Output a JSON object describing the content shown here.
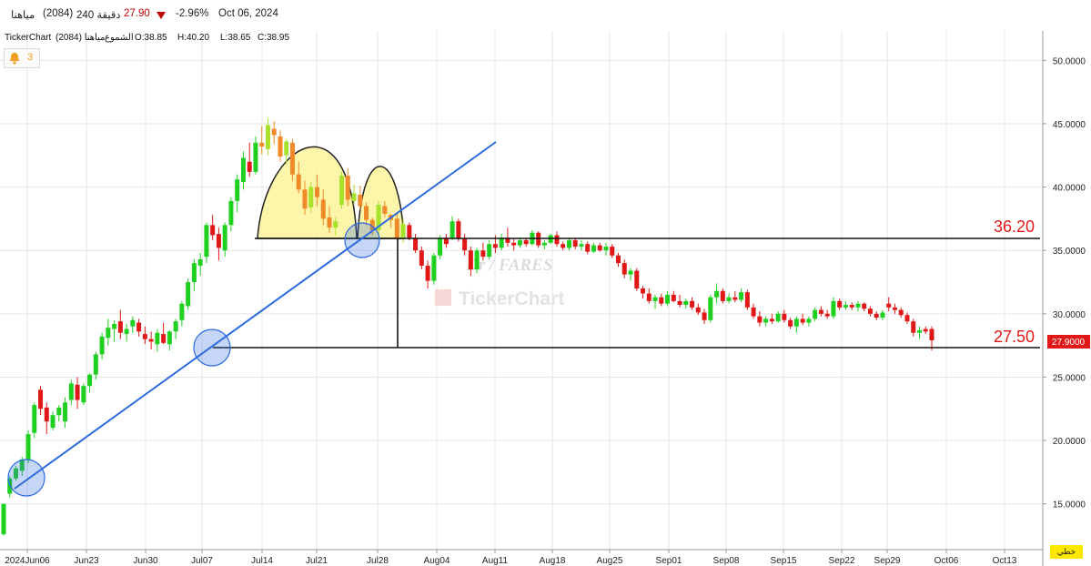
{
  "header": {
    "symbol_name": "مياهنا",
    "symbol_code": "(2084)",
    "interval": "240 دقيقة",
    "price": "27.90",
    "change_pct": "-2.96%",
    "date": "Oct 06, 2024"
  },
  "infobar": {
    "source": "TickerChart",
    "symbol": "مياهنا (2084)",
    "type": "الشموع",
    "open": "O:38.85",
    "high": "H:40.20",
    "low": "L:38.65",
    "close": "C:38.95"
  },
  "alerts": {
    "count": "3"
  },
  "corner_label": "خطي",
  "watermarks": {
    "author": "Dr / FARES",
    "brand": "TickerChart"
  },
  "colors": {
    "up": "#20d020",
    "down": "#e01818",
    "hl_up": "#a8e22c",
    "hl_down": "#f08a28",
    "trendline": "#2d6be0",
    "pattern_fill": "#fdf39a",
    "label": "#e01818",
    "grid": "#e6e6e6"
  },
  "chart_data": {
    "type": "candlestick",
    "ylim": [
      12.5,
      52.5
    ],
    "yticks": [
      "15.0000",
      "20.0000",
      "25.0000",
      "30.0000",
      "35.0000",
      "40.0000",
      "45.0000",
      "50.0000"
    ],
    "grid": true,
    "x_labels": [
      "2024Jun06",
      "Jun23",
      "Jun30",
      "Jul07",
      "Jul14",
      "Jul21",
      "Jul28",
      "Aug04",
      "Aug11",
      "Aug18",
      "Aug25",
      "Sep01",
      "Sep08",
      "Sep15",
      "Sep22",
      "Sep29",
      "Oct06",
      "Oct13"
    ],
    "last_price": "27.9000",
    "levels": [
      {
        "value": 36.2,
        "label": "36.20"
      },
      {
        "value": 27.5,
        "label": "27.50"
      }
    ],
    "candles": [
      [
        12.6,
        15.0,
        12.5,
        15.0
      ],
      [
        15.8,
        17.2,
        15.5,
        17.0
      ],
      [
        17.0,
        18.0,
        16.8,
        17.8
      ],
      [
        17.6,
        18.7,
        17.2,
        18.5
      ],
      [
        18.5,
        20.8,
        18.2,
        20.5
      ],
      [
        20.6,
        23.0,
        20.2,
        22.8
      ],
      [
        24.0,
        24.3,
        22.0,
        22.5
      ],
      [
        22.6,
        23.0,
        20.5,
        21.5
      ],
      [
        21.0,
        22.3,
        20.8,
        22.0
      ],
      [
        22.0,
        22.8,
        21.5,
        22.6
      ],
      [
        21.5,
        23.4,
        21.0,
        23.0
      ],
      [
        23.2,
        24.8,
        22.8,
        24.5
      ],
      [
        24.4,
        25.0,
        22.5,
        23.2
      ],
      [
        23.0,
        24.5,
        22.8,
        24.3
      ],
      [
        24.3,
        25.3,
        23.8,
        25.2
      ],
      [
        25.2,
        27.0,
        24.8,
        26.8
      ],
      [
        26.8,
        28.5,
        26.4,
        28.2
      ],
      [
        28.1,
        29.6,
        27.5,
        28.9
      ],
      [
        28.8,
        29.5,
        27.8,
        29.2
      ],
      [
        29.4,
        30.3,
        28.0,
        28.5
      ],
      [
        28.4,
        29.2,
        27.8,
        28.8
      ],
      [
        29.0,
        29.8,
        28.5,
        29.5
      ],
      [
        29.3,
        29.6,
        28.2,
        28.6
      ],
      [
        28.4,
        29.0,
        27.6,
        28.0
      ],
      [
        28.0,
        28.6,
        27.2,
        27.8
      ],
      [
        27.6,
        28.8,
        27.0,
        28.5
      ],
      [
        28.4,
        29.3,
        27.6,
        27.7
      ],
      [
        27.6,
        28.7,
        27.1,
        28.6
      ],
      [
        28.6,
        29.6,
        28.0,
        29.4
      ],
      [
        29.5,
        31.0,
        29.0,
        30.8
      ],
      [
        30.6,
        32.8,
        30.3,
        32.5
      ],
      [
        32.5,
        34.3,
        31.8,
        34.0
      ],
      [
        33.8,
        34.8,
        33.0,
        34.3
      ],
      [
        34.5,
        37.2,
        34.0,
        37.0
      ],
      [
        37.0,
        37.8,
        35.8,
        36.2
      ],
      [
        36.3,
        36.8,
        34.2,
        35.2
      ],
      [
        35.0,
        37.2,
        34.5,
        37.0
      ],
      [
        37.0,
        39.2,
        36.5,
        38.9
      ],
      [
        38.9,
        41.0,
        38.0,
        40.6
      ],
      [
        40.4,
        42.8,
        39.8,
        42.3
      ],
      [
        42.0,
        43.5,
        40.8,
        41.2
      ],
      [
        41.2,
        44.0,
        41.0,
        43.5
      ],
      [
        43.5,
        44.8,
        42.6,
        43.2
      ],
      [
        43.0,
        45.4,
        42.5,
        44.9
      ],
      [
        44.6,
        45.2,
        43.4,
        44.1
      ],
      [
        44.0,
        44.5,
        42.0,
        42.4
      ],
      [
        42.5,
        43.8,
        41.8,
        43.6
      ],
      [
        43.5,
        43.8,
        40.5,
        41.0
      ],
      [
        41.0,
        42.0,
        39.5,
        39.8
      ],
      [
        39.8,
        40.5,
        37.8,
        38.3
      ],
      [
        38.4,
        40.4,
        38.0,
        40.0
      ],
      [
        40.0,
        41.0,
        38.5,
        39.2
      ],
      [
        39.0,
        39.8,
        37.0,
        37.5
      ],
      [
        37.6,
        38.5,
        36.4,
        36.8
      ],
      [
        36.8,
        37.6,
        36.2,
        37.3
      ],
      [
        38.6,
        41.2,
        38.3,
        40.9
      ],
      [
        40.9,
        41.5,
        38.5,
        39.0
      ],
      [
        38.9,
        40.2,
        38.6,
        39.5
      ],
      [
        39.4,
        40.1,
        38.2,
        38.5
      ],
      [
        38.5,
        38.8,
        37.0,
        37.4
      ],
      [
        37.4,
        37.6,
        36.2,
        36.6
      ],
      [
        36.6,
        38.9,
        36.3,
        38.6
      ],
      [
        38.5,
        38.9,
        37.6,
        37.9
      ],
      [
        37.8,
        37.9,
        36.8,
        37.4
      ],
      [
        37.5,
        37.9,
        35.8,
        36.0
      ],
      [
        36.0,
        37.5,
        35.6,
        37.1
      ],
      [
        37.0,
        37.2,
        35.8,
        36.0
      ],
      [
        36.0,
        36.3,
        34.8,
        35.0
      ],
      [
        35.0,
        35.3,
        33.5,
        33.8
      ],
      [
        33.8,
        34.2,
        32.0,
        32.6
      ],
      [
        32.6,
        34.8,
        32.3,
        34.6
      ],
      [
        34.6,
        36.2,
        34.3,
        36.0
      ],
      [
        36.0,
        36.3,
        35.2,
        35.5
      ],
      [
        36.0,
        37.7,
        35.8,
        37.3
      ],
      [
        37.3,
        37.5,
        35.7,
        35.9
      ],
      [
        35.9,
        36.3,
        34.6,
        35.0
      ],
      [
        35.0,
        35.3,
        33.0,
        33.5
      ],
      [
        33.5,
        35.2,
        33.2,
        35.0
      ],
      [
        35.0,
        35.6,
        34.2,
        34.5
      ],
      [
        34.5,
        35.8,
        34.3,
        35.5
      ],
      [
        35.5,
        36.2,
        34.8,
        35.2
      ],
      [
        35.2,
        36.3,
        35.0,
        36.0
      ],
      [
        36.0,
        36.8,
        35.3,
        35.6
      ],
      [
        35.6,
        35.9,
        35.0,
        35.4
      ],
      [
        35.4,
        36.0,
        35.2,
        35.8
      ],
      [
        35.8,
        36.0,
        35.3,
        35.5
      ],
      [
        35.5,
        36.6,
        35.4,
        36.4
      ],
      [
        36.4,
        36.5,
        35.2,
        35.4
      ],
      [
        35.4,
        35.8,
        35.1,
        35.6
      ],
      [
        35.6,
        36.3,
        35.5,
        36.2
      ],
      [
        36.2,
        36.5,
        35.3,
        35.5
      ],
      [
        35.5,
        35.7,
        35.0,
        35.2
      ],
      [
        35.2,
        36.0,
        35.0,
        35.8
      ],
      [
        35.8,
        36.0,
        35.1,
        35.3
      ],
      [
        35.3,
        35.8,
        35.0,
        35.5
      ],
      [
        35.5,
        35.7,
        34.7,
        34.9
      ],
      [
        34.9,
        35.6,
        34.8,
        35.4
      ],
      [
        35.4,
        35.6,
        34.9,
        35.0
      ],
      [
        35.0,
        35.6,
        34.6,
        35.3
      ],
      [
        35.3,
        35.5,
        34.4,
        34.6
      ],
      [
        34.6,
        34.8,
        33.7,
        34.0
      ],
      [
        34.0,
        34.3,
        32.8,
        33.1
      ],
      [
        33.1,
        33.6,
        32.6,
        33.4
      ],
      [
        33.4,
        33.6,
        31.8,
        32.0
      ],
      [
        32.0,
        32.2,
        31.2,
        31.6
      ],
      [
        31.6,
        32.0,
        30.8,
        31.0
      ],
      [
        31.0,
        31.5,
        30.4,
        31.3
      ],
      [
        31.3,
        31.6,
        30.6,
        30.8
      ],
      [
        30.8,
        31.8,
        30.6,
        31.5
      ],
      [
        31.5,
        31.8,
        30.9,
        31.0
      ],
      [
        31.0,
        31.5,
        30.5,
        30.7
      ],
      [
        30.7,
        31.2,
        30.4,
        31.0
      ],
      [
        31.0,
        31.3,
        30.3,
        30.5
      ],
      [
        30.5,
        30.8,
        29.9,
        30.1
      ],
      [
        30.1,
        30.4,
        29.2,
        29.5
      ],
      [
        29.5,
        31.5,
        29.3,
        31.3
      ],
      [
        31.3,
        32.4,
        30.8,
        31.8
      ],
      [
        31.8,
        32.0,
        30.8,
        31.0
      ],
      [
        31.0,
        31.6,
        30.8,
        31.3
      ],
      [
        31.3,
        31.8,
        30.9,
        31.1
      ],
      [
        31.1,
        32.0,
        30.9,
        31.7
      ],
      [
        31.7,
        31.9,
        30.3,
        30.5
      ],
      [
        30.5,
        30.8,
        29.6,
        29.8
      ],
      [
        29.8,
        30.2,
        29.0,
        29.3
      ],
      [
        29.3,
        29.8,
        29.0,
        29.6
      ],
      [
        29.6,
        30.0,
        29.2,
        29.4
      ],
      [
        29.4,
        30.2,
        29.3,
        30.0
      ],
      [
        30.0,
        30.3,
        29.3,
        29.5
      ],
      [
        29.5,
        29.7,
        28.8,
        29.0
      ],
      [
        29.0,
        29.8,
        28.5,
        29.6
      ],
      [
        29.6,
        30.0,
        29.1,
        29.3
      ],
      [
        29.3,
        29.8,
        29.0,
        29.6
      ],
      [
        29.6,
        30.5,
        29.4,
        30.3
      ],
      [
        30.3,
        30.6,
        29.8,
        30.0
      ],
      [
        30.0,
        30.3,
        29.6,
        29.8
      ],
      [
        29.8,
        31.3,
        29.6,
        31.0
      ],
      [
        31.0,
        31.2,
        30.3,
        30.5
      ],
      [
        30.5,
        31.0,
        30.3,
        30.7
      ],
      [
        30.7,
        30.9,
        30.3,
        30.5
      ],
      [
        30.5,
        31.0,
        30.2,
        30.8
      ],
      [
        30.8,
        30.9,
        30.2,
        30.4
      ],
      [
        30.4,
        30.6,
        29.8,
        30.0
      ],
      [
        30.0,
        30.2,
        29.5,
        29.7
      ],
      [
        29.7,
        30.3,
        29.5,
        30.1
      ],
      [
        30.8,
        31.3,
        30.2,
        30.5
      ],
      [
        30.5,
        30.8,
        30.0,
        30.3
      ],
      [
        30.3,
        30.5,
        29.7,
        29.9
      ],
      [
        29.9,
        30.1,
        29.2,
        29.4
      ],
      [
        29.4,
        29.6,
        28.2,
        28.5
      ],
      [
        28.5,
        29.0,
        28.0,
        28.7
      ],
      [
        28.8,
        29.0,
        28.4,
        28.6
      ],
      [
        28.8,
        29.0,
        27.1,
        27.9
      ]
    ]
  }
}
